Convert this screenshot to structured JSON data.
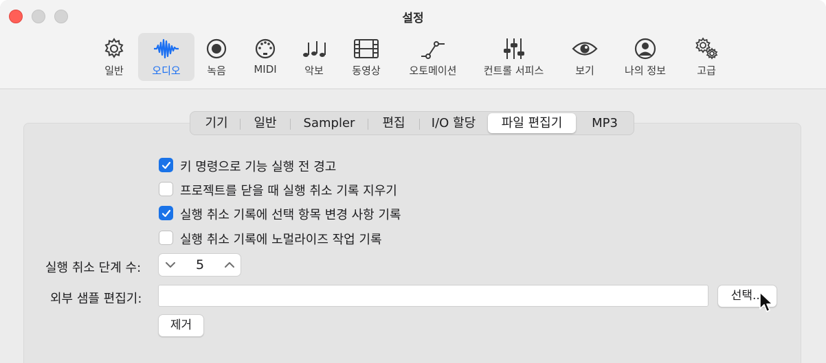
{
  "window": {
    "title": "설정"
  },
  "toolbar": {
    "items": [
      {
        "label": "일반",
        "icon": "gear-icon"
      },
      {
        "label": "오디오",
        "icon": "waveform-icon",
        "active": true
      },
      {
        "label": "녹음",
        "icon": "record-icon"
      },
      {
        "label": "MIDI",
        "icon": "midi-port-icon"
      },
      {
        "label": "악보",
        "icon": "music-notes-icon"
      },
      {
        "label": "동영상",
        "icon": "film-icon"
      },
      {
        "label": "오토메이션",
        "icon": "automation-curve-icon"
      },
      {
        "label": "컨트롤 서피스",
        "icon": "sliders-icon"
      },
      {
        "label": "보기",
        "icon": "eye-icon"
      },
      {
        "label": "나의 정보",
        "icon": "person-icon"
      },
      {
        "label": "고급",
        "icon": "gears-icon"
      }
    ]
  },
  "tabs": [
    {
      "label": "기기"
    },
    {
      "label": "일반"
    },
    {
      "label": "Sampler"
    },
    {
      "label": "편집"
    },
    {
      "label": "I/O 할당"
    },
    {
      "label": "파일 편집기",
      "active": true
    },
    {
      "label": "MP3"
    }
  ],
  "options": [
    {
      "label": "키 명령으로 기능 실행 전 경고",
      "checked": true
    },
    {
      "label": "프로젝트를 닫을 때 실행 취소 기록 지우기",
      "checked": false
    },
    {
      "label": "실행 취소 기록에 선택 항목 변경 사항 기록",
      "checked": true
    },
    {
      "label": "실행 취소 기록에 노멀라이즈 작업 기록",
      "checked": false
    }
  ],
  "undo_steps": {
    "label": "실행 취소 단계 수:",
    "value": "5"
  },
  "external_editor": {
    "label": "외부 샘플 편집기:",
    "value": "",
    "choose_label": "선택...",
    "remove_label": "제거"
  },
  "colors": {
    "accent": "#1a73e8",
    "close": "#ff5f57"
  }
}
